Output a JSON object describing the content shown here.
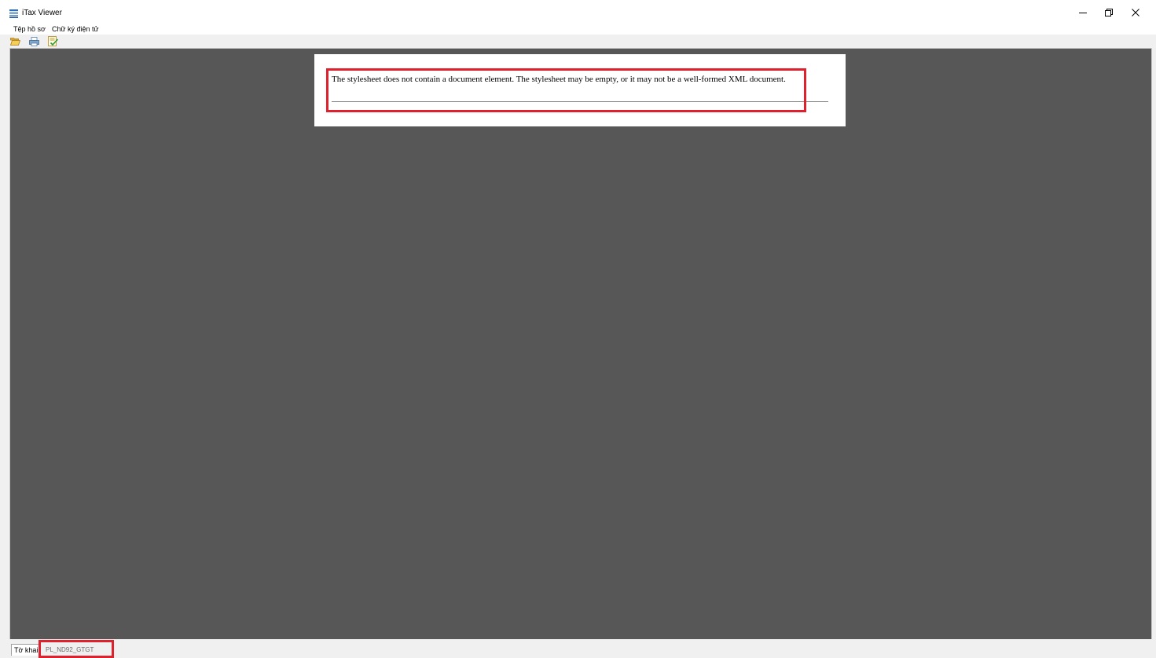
{
  "window": {
    "title": "iTax Viewer",
    "icon": "app-icon"
  },
  "menu": {
    "items": [
      {
        "label": "Tệp hồ sơ"
      },
      {
        "label": "Chữ ký điện tử"
      }
    ]
  },
  "toolbar": {
    "buttons": [
      {
        "icon": "folder-open-icon",
        "name": "open"
      },
      {
        "icon": "printer-icon",
        "name": "print"
      },
      {
        "icon": "signature-check-icon",
        "name": "verify-signature"
      }
    ]
  },
  "document": {
    "error_message": "The stylesheet does not contain a document element. The stylesheet may be empty, or it may not be a well-formed XML document."
  },
  "tabs": [
    {
      "label": "Tờ khai",
      "active": true
    },
    {
      "label": "PL_ND92_GTGT",
      "active": false
    }
  ],
  "colors": {
    "viewer_background": "#575757",
    "highlight": "#e0202c"
  }
}
